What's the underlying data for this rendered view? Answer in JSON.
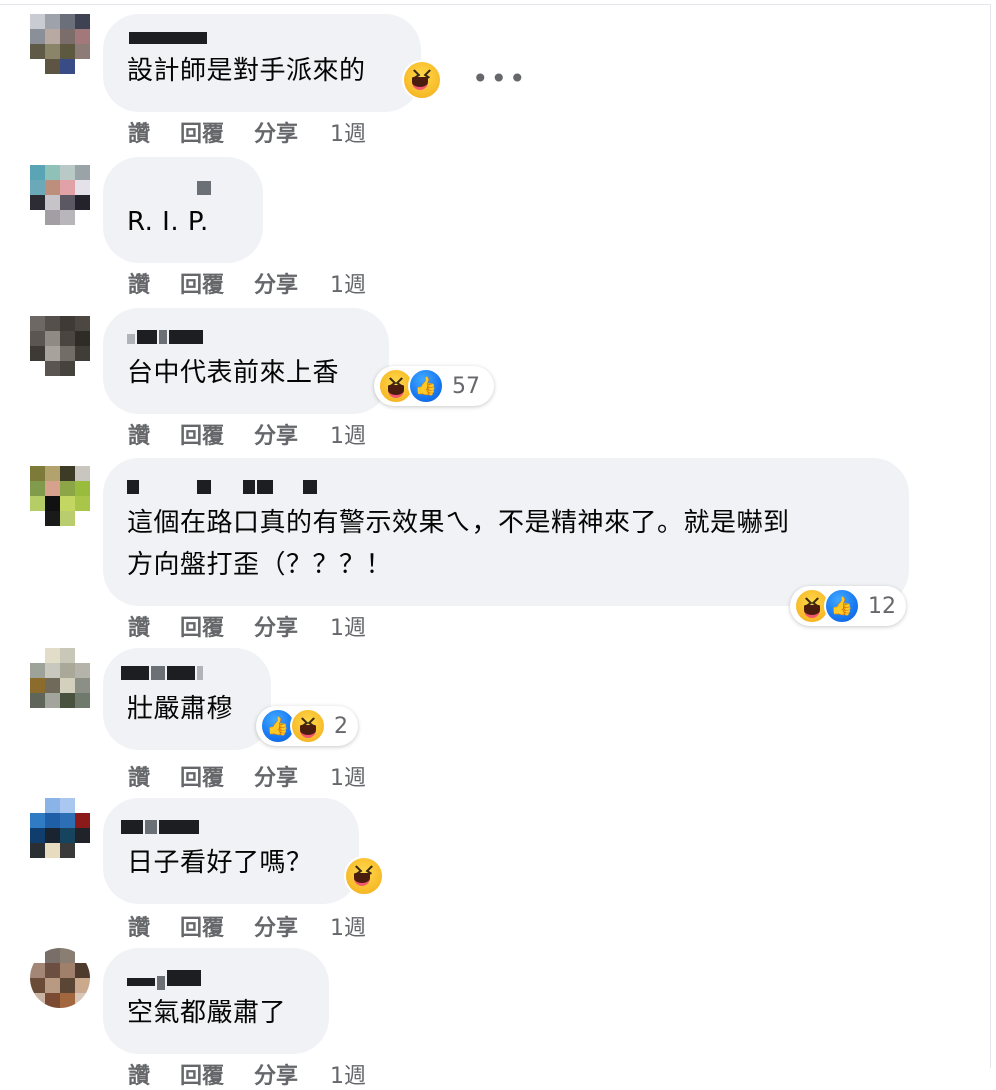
{
  "comments": [
    {
      "text": "設計師是對手派來的",
      "reactions": {
        "icons": [
          "haha"
        ],
        "count": ""
      },
      "actions": {
        "like": "讚",
        "reply": "回覆",
        "share": "分享",
        "time": "1週"
      }
    },
    {
      "text": "R. I. P.",
      "reactions": null,
      "actions": {
        "like": "讚",
        "reply": "回覆",
        "share": "分享",
        "time": "1週"
      }
    },
    {
      "text": "台中代表前來上香",
      "reactions": {
        "icons": [
          "haha",
          "like"
        ],
        "count": "57"
      },
      "actions": {
        "like": "讚",
        "reply": "回覆",
        "share": "分享",
        "time": "1週"
      }
    },
    {
      "text": "這個在路口真的有警示效果ㄟ，不是精神來了。就是嚇到\n方向盤打歪（？？？！",
      "reactions": {
        "icons": [
          "haha",
          "like"
        ],
        "count": "12"
      },
      "actions": {
        "like": "讚",
        "reply": "回覆",
        "share": "分享",
        "time": "1週"
      }
    },
    {
      "text": "壯嚴肅穆",
      "reactions": {
        "icons": [
          "like",
          "haha"
        ],
        "count": "2"
      },
      "actions": {
        "like": "讚",
        "reply": "回覆",
        "share": "分享",
        "time": "1週"
      }
    },
    {
      "text": "日子看好了嗎？",
      "reactions": {
        "icons": [
          "haha"
        ],
        "count": ""
      },
      "actions": {
        "like": "讚",
        "reply": "回覆",
        "share": "分享",
        "time": "1週"
      }
    },
    {
      "text": "空氣都嚴肅了",
      "reactions": null,
      "actions": {
        "like": "讚",
        "reply": "回覆",
        "share": "分享",
        "time": "1週"
      }
    }
  ],
  "more_options": "•••",
  "colors": {
    "bubble": "#f0f2f5",
    "secondary_text": "#65676b",
    "like_blue": "#1877f2",
    "haha_yellow": "#f7b928"
  }
}
